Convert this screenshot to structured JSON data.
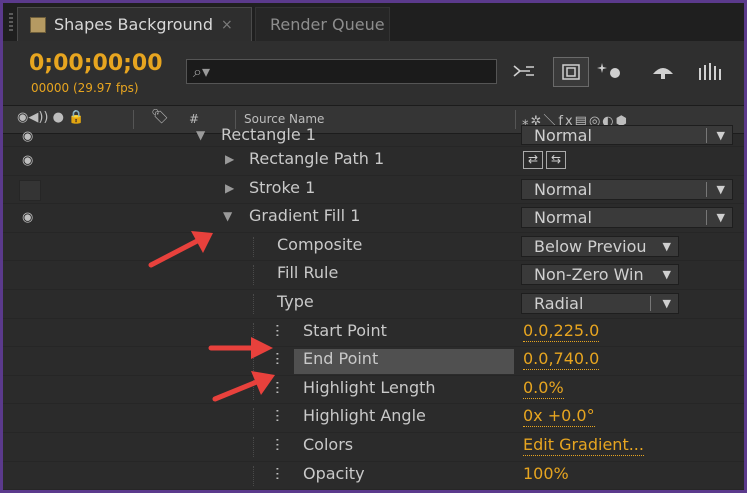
{
  "tabs": [
    {
      "label": "Shapes Background",
      "close": "×"
    },
    {
      "label": "Render Queue"
    }
  ],
  "header": {
    "timecode": "0;00;00;00",
    "fps": "00000 (29.97 fps)",
    "search": {
      "placeholder": "",
      "icon": "search-icon"
    }
  },
  "columns": {
    "hash": "#",
    "source_name": "Source Name"
  },
  "layers": [
    {
      "label": "Rectangle 1",
      "mode": "Normal"
    },
    {
      "label": "Rectangle Path 1"
    },
    {
      "label": "Stroke 1",
      "mode": "Normal"
    },
    {
      "label": "Gradient Fill 1",
      "mode": "Normal"
    },
    {
      "label": "Composite",
      "value": "Below Previou"
    },
    {
      "label": "Fill Rule",
      "value": "Non-Zero Win"
    },
    {
      "label": "Type",
      "value": "Radial"
    },
    {
      "label": "Start Point",
      "value": "0.0,225.0"
    },
    {
      "label": "End Point",
      "value": "0.0,740.0"
    },
    {
      "label": "Highlight Length",
      "value": "0.0%"
    },
    {
      "label": "Highlight Angle",
      "value": "0x +0.0°"
    },
    {
      "label": "Colors",
      "value": "Edit Gradient..."
    },
    {
      "label": "Opacity",
      "value": "100%"
    }
  ],
  "colors": {
    "accent": "#e7a520",
    "annotation_arrow": "#e8413c",
    "border": "#5b3a8c"
  }
}
